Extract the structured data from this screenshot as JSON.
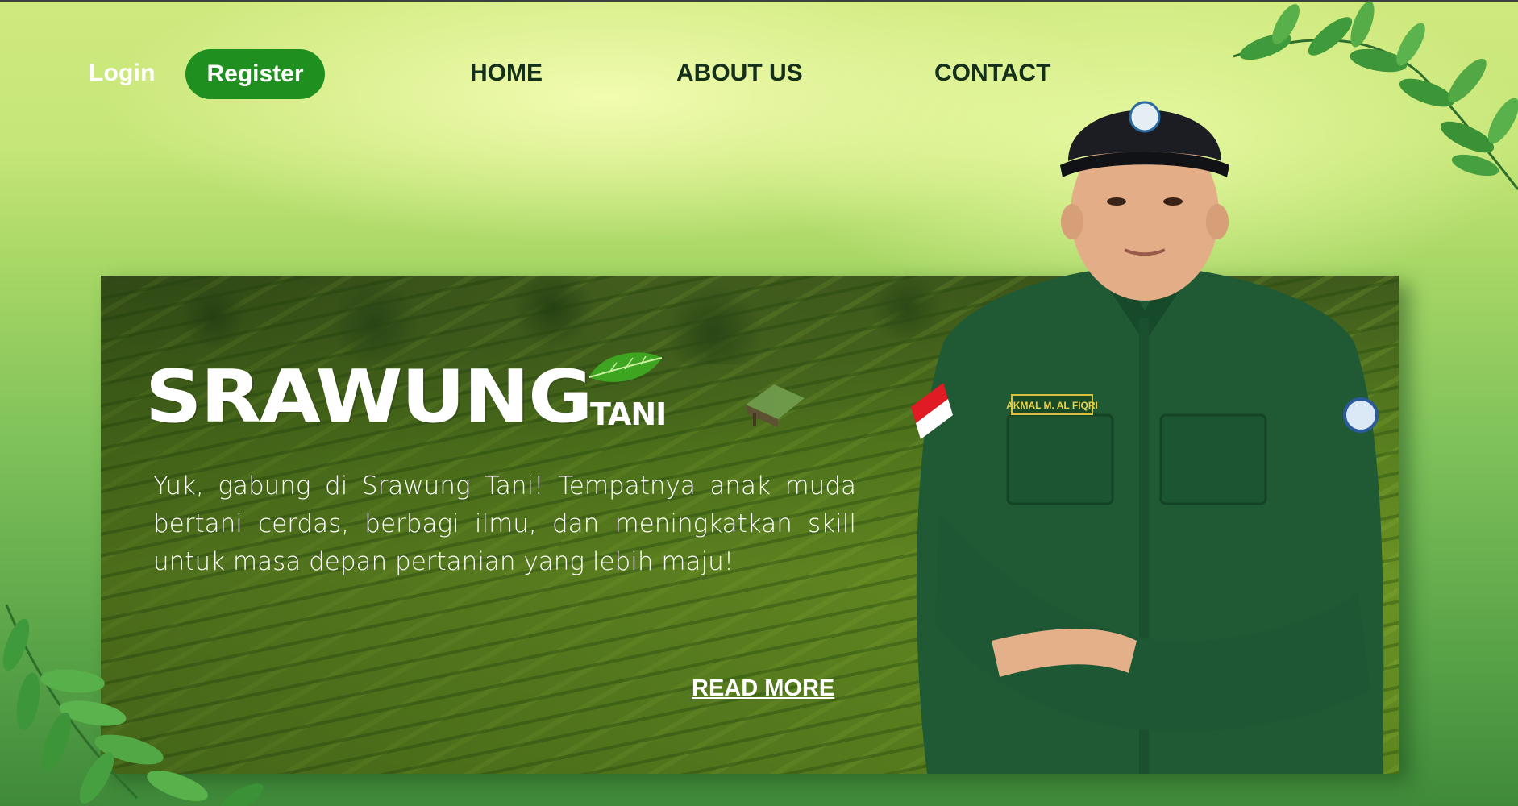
{
  "nav": {
    "login_label": "Login",
    "register_label": "Register",
    "home_label": "HOME",
    "about_label": "ABOUT US",
    "contact_label": "CONTACT"
  },
  "hero": {
    "logo_main": "SRAWUNG",
    "logo_sub": "TANI",
    "description": "Yuk, gabung di Srawung Tani! Tempatnya anak muda bertani cerdas, berbagi ilmu, dan meningkatkan skill untuk masa depan pertanian yang lebih maju!",
    "read_more_label": "READ MORE",
    "name_tag": "AKMAL M. AL FIQRI"
  },
  "icons": {
    "logo_leaf": "leaf-icon",
    "flag": "indonesia-flag-icon",
    "cap_badge": "emblem-icon"
  },
  "colors": {
    "register_bg": "#1f8f1f",
    "nav_text": "#15301a",
    "uniform": "#1f5a35"
  }
}
